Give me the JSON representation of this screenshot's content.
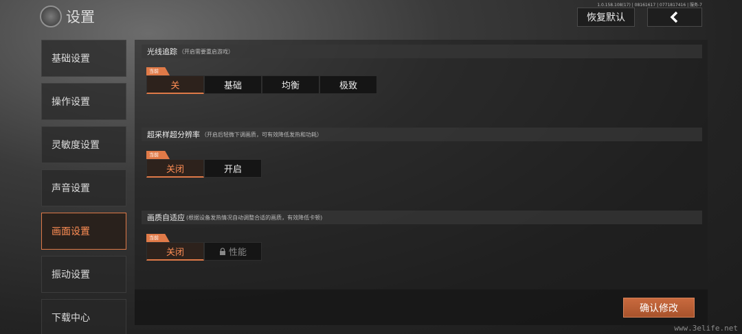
{
  "header": {
    "title": "设置",
    "version": "1.0.158.108(17) | 08161617 | 0771817416 | 服务-7",
    "reset_label": "恢复默认"
  },
  "sidebar": {
    "items": [
      {
        "label": "基础设置"
      },
      {
        "label": "操作设置"
      },
      {
        "label": "灵敏度设置"
      },
      {
        "label": "声音设置"
      },
      {
        "label": "画面设置"
      },
      {
        "label": "振动设置"
      },
      {
        "label": "下载中心"
      }
    ],
    "active_index": 4
  },
  "sections": {
    "ray_tracing": {
      "title": "光线追踪",
      "note": "（开启需要重启游戏）",
      "tag": "当前",
      "options": [
        "关",
        "基础",
        "均衡",
        "极致"
      ],
      "selected": "关"
    },
    "super_resolution": {
      "title": "超采样超分辨率",
      "note": "（开启后轻微下调画质，可有效降低发热和功耗）",
      "tag": "当前",
      "options": [
        "关闭",
        "开启"
      ],
      "selected": "关闭"
    },
    "adaptive_quality": {
      "title": "画质自适应",
      "note": "(根据设备发热情况自动调整合适的画质，有效降低卡顿)",
      "tag": "当前",
      "options": [
        "关闭",
        "性能"
      ],
      "selected": "关闭",
      "locked": "性能"
    }
  },
  "footer": {
    "confirm_label": "确认修改"
  },
  "watermark": "www.3elife.net",
  "colors": {
    "accent": "#e07a48"
  }
}
